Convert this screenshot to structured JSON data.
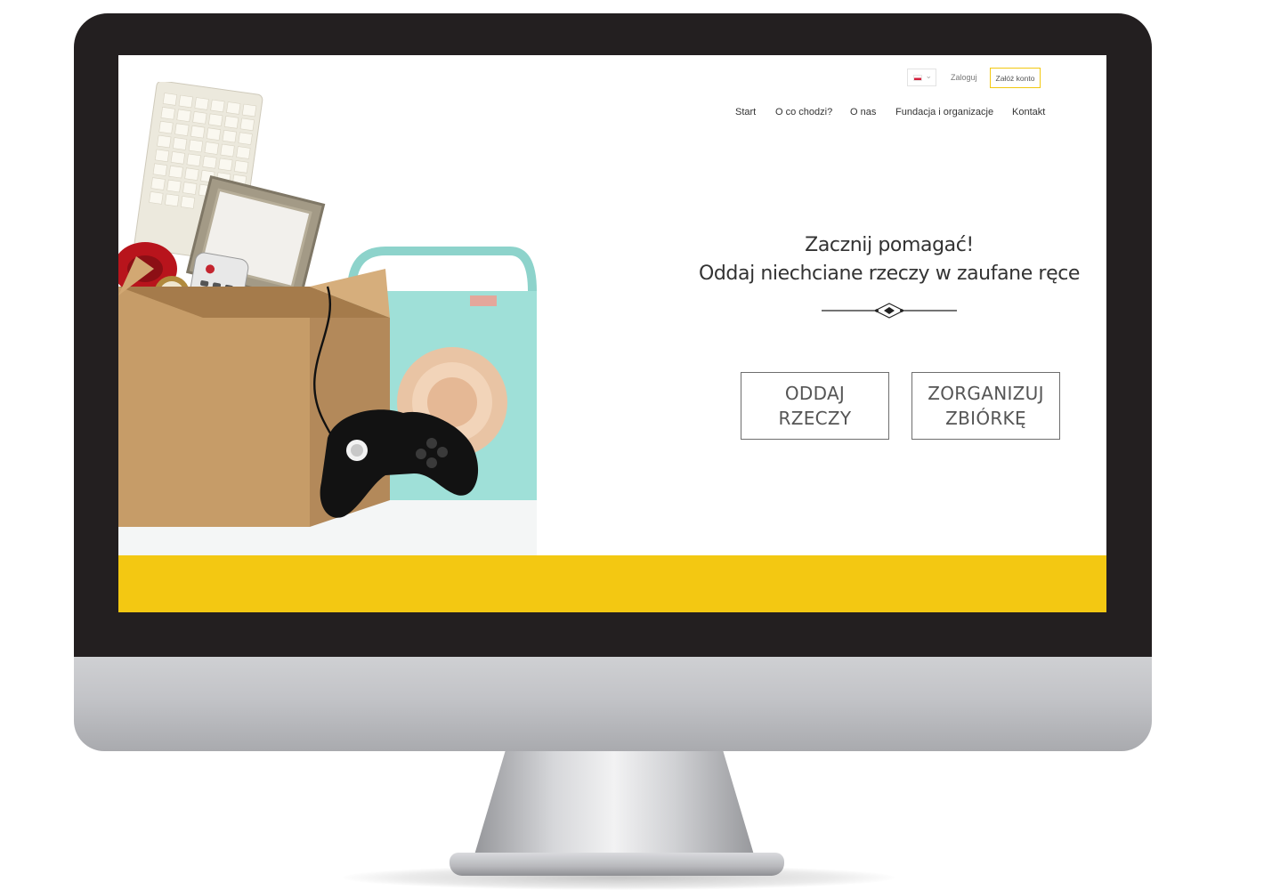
{
  "colors": {
    "accent_yellow": "#f3c812",
    "bezel": "#231f20",
    "text": "#333333"
  },
  "header": {
    "language": {
      "flag_icon": "poland-flag-icon",
      "chevron_icon": "chevron-down-icon"
    },
    "login_label": "Zaloguj",
    "register_label": "Załóż konto"
  },
  "nav": {
    "items": [
      {
        "label": "Start"
      },
      {
        "label": "O co chodzi?"
      },
      {
        "label": "O nas"
      },
      {
        "label": "Fundacja i organizacje"
      },
      {
        "label": "Kontakt"
      }
    ]
  },
  "hero": {
    "title_line1": "Zacznij pomagać!",
    "title_line2": "Oddaj niechciane rzeczy w zaufane ręce",
    "image_icon": "box-of-items-image",
    "buttons": {
      "give": {
        "line1": "ODDAJ",
        "line2": "RZECZY"
      },
      "organize": {
        "line1": "ZORGANIZUJ",
        "line2": "ZBIÓRKĘ"
      }
    }
  }
}
